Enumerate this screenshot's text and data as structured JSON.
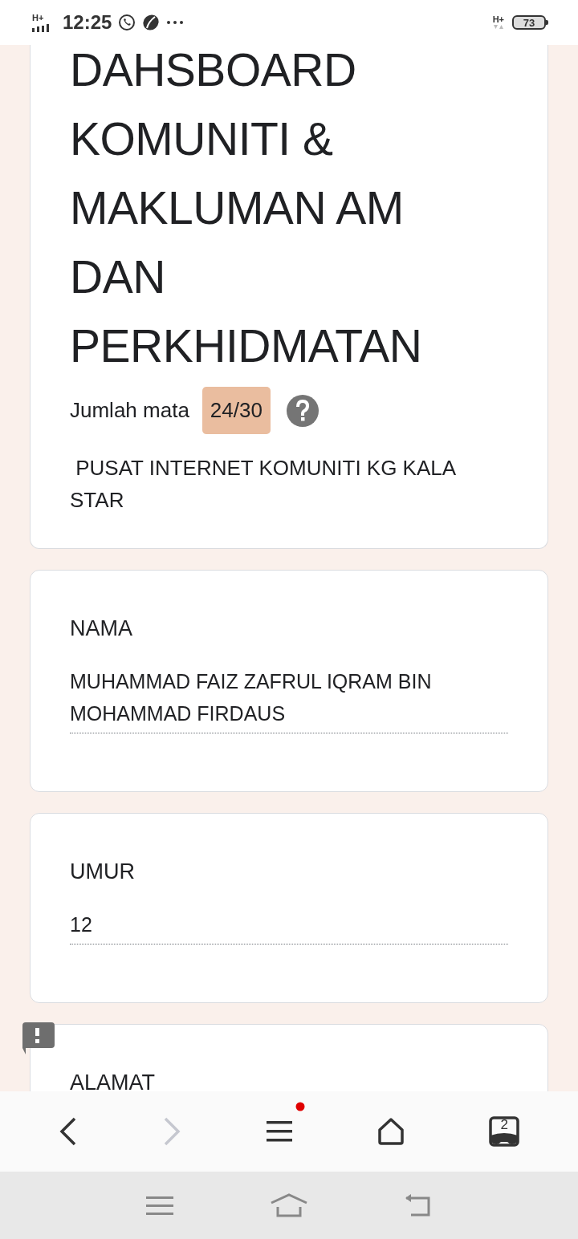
{
  "status_bar": {
    "network_left": "H+",
    "time": "12:25",
    "network_right": "H+",
    "battery": "73"
  },
  "header": {
    "title": "DAHSBOARD KOMUNITI & MAKLUMAN AM DAN PERKHIDMATAN",
    "score_label": "Jumlah mata",
    "score": "24/30",
    "description": " PUSAT INTERNET KOMUNITI KG KALA STAR"
  },
  "questions": [
    {
      "label": "NAMA",
      "value": "MUHAMMAD FAIZ ZAFRUL IQRAM BIN MOHAMMAD FIRDAUS",
      "flagged": false
    },
    {
      "label": "UMUR",
      "value": "12",
      "flagged": false
    },
    {
      "label": "ALAMAT",
      "flagged": true
    }
  ],
  "browser_toolbar": {
    "forward_disabled": true,
    "menu_notification": true,
    "tab_count": "2"
  }
}
